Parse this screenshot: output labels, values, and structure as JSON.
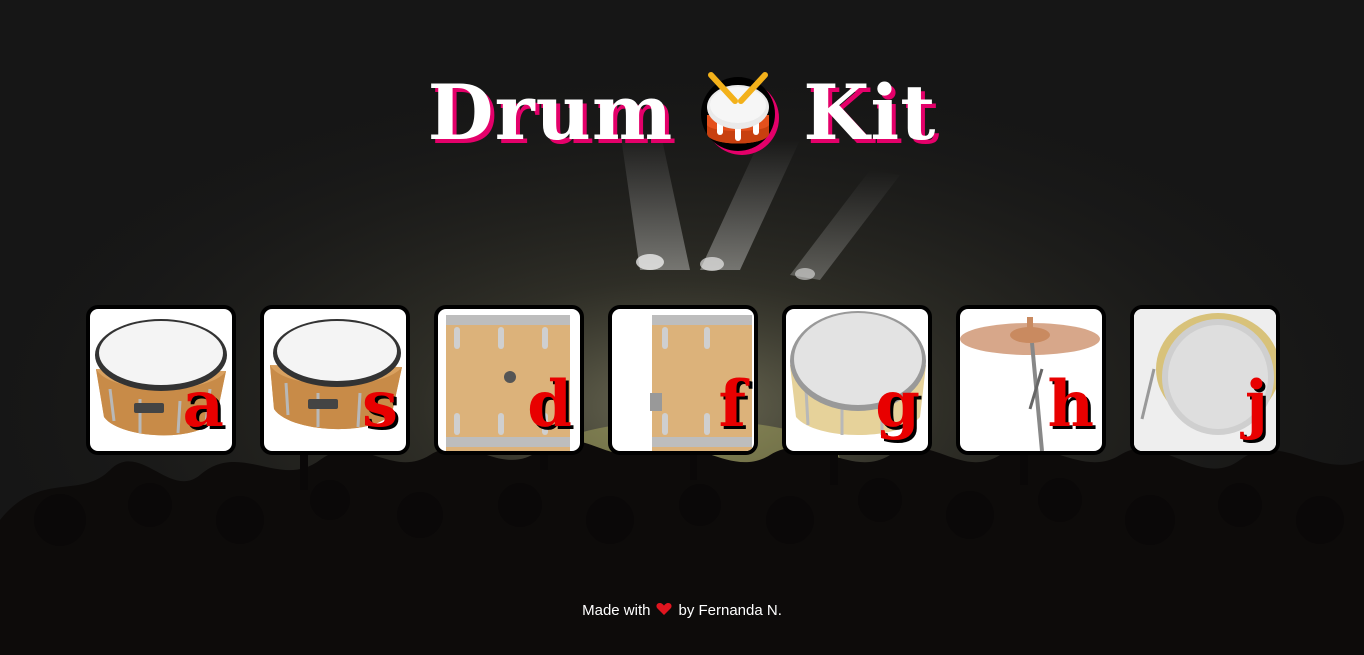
{
  "page": {
    "title_left": "Drum",
    "title_right": "Kit",
    "title_icon": "drum-with-sticks-icon",
    "colors": {
      "letter": "#e80000",
      "title_shadow": "#e4006a",
      "key_border": "#000000",
      "heart": "#e0151f"
    }
  },
  "keys": [
    {
      "letter": "a",
      "icon": "snare-drum-icon"
    },
    {
      "letter": "s",
      "icon": "snare-drum-icon"
    },
    {
      "letter": "d",
      "icon": "floor-tom-icon"
    },
    {
      "letter": "f",
      "icon": "floor-tom-icon"
    },
    {
      "letter": "g",
      "icon": "tom-drum-icon"
    },
    {
      "letter": "h",
      "icon": "cymbal-icon"
    },
    {
      "letter": "j",
      "icon": "bass-drum-icon"
    }
  ],
  "footer": {
    "before": "Made with",
    "icon": "heart-icon",
    "after": "by Fernanda N."
  }
}
